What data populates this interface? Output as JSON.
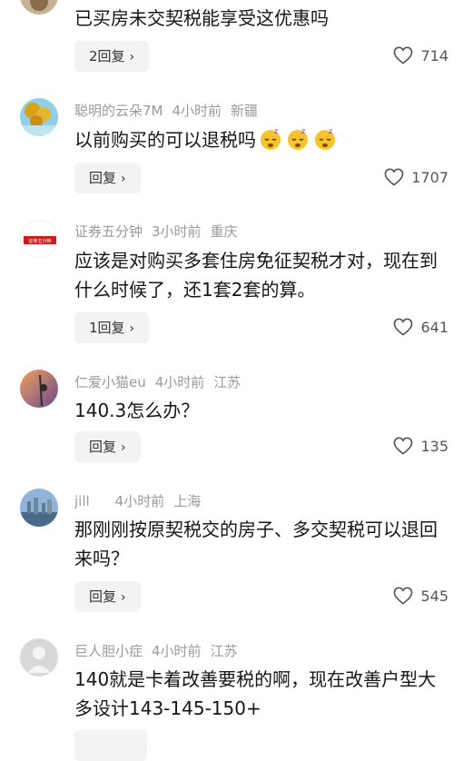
{
  "comments": [
    {
      "text": "已买房未交契税能享受这优惠吗",
      "reply_label": "2回复",
      "likes": "714"
    },
    {
      "username": "聪明的云朵7M",
      "time": "4小时前",
      "location": "新疆",
      "text": "以前购买的可以退税吗",
      "reply_label": "回复",
      "likes": "1707"
    },
    {
      "username": "证券五分钟",
      "time": "3小时前",
      "location": "重庆",
      "avatar_text": "证券五分钟",
      "text": "应该是对购买多套住房免征契税才对，现在到什么时候了，还1套2套的算。",
      "reply_label": "1回复",
      "likes": "641"
    },
    {
      "username": "仁爱小猫eu",
      "time": "4小时前",
      "location": "江苏",
      "text": "140.3怎么办？",
      "reply_label": "回复",
      "likes": "135"
    },
    {
      "username": "jill",
      "time": "4小时前",
      "location": "上海",
      "text": "那刚刚按原契税交的房子、多交契税可以退回来吗？",
      "reply_label": "回复",
      "likes": "545"
    },
    {
      "username": "巨人胆小症",
      "time": "4小时前",
      "location": "江苏",
      "text": "140就是卡着改善要税的啊，现在改善户型大多设计143-145-150+"
    }
  ],
  "icons": {
    "reply_chevron": "chevron-right-icon",
    "like": "heart-outline-icon",
    "emoji": "sleeping-face-emoji"
  },
  "colors": {
    "meta_text": "#9a9a9a",
    "reply_bg": "#f3f3f3"
  }
}
